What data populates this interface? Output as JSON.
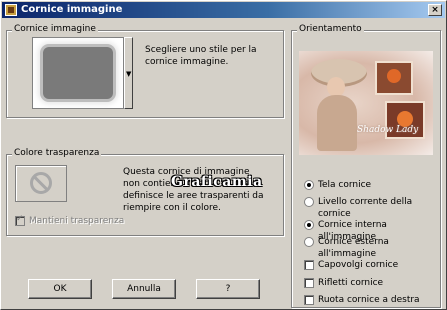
{
  "window": {
    "title": "Cornice immagine",
    "close_glyph": "×"
  },
  "frame_group": {
    "label": "Cornice immagine",
    "description": "Scegliere uno stile per la cornice immagine."
  },
  "color_group": {
    "label": "Colore trasparenza",
    "description": "Questa cornice di immagine non contiene un'area di che definisce le aree trasparenti da riempire con il colore.",
    "keep_transparency_label": "Mantieni trasparenza",
    "keep_transparency_checked": true
  },
  "orientation_group": {
    "label": "Orientamento",
    "preview_script": "Shadow Lady",
    "options_apply": [
      {
        "label": "Tela cornice",
        "selected": true
      },
      {
        "label": "Livello corrente della cornice",
        "selected": false
      }
    ],
    "options_side": [
      {
        "label": "Cornice interna all'immagine",
        "selected": true
      },
      {
        "label": "Cornice esterna all'immagine",
        "selected": false
      }
    ],
    "checkboxes": [
      {
        "label": "Capovolgi cornice",
        "checked": false
      },
      {
        "label": "Rifletti cornice",
        "checked": false
      },
      {
        "label": "Ruota cornice a destra",
        "checked": false
      }
    ]
  },
  "buttons": {
    "ok": "OK",
    "cancel": "Annulla",
    "help": "?"
  },
  "watermark": "Graficamia"
}
